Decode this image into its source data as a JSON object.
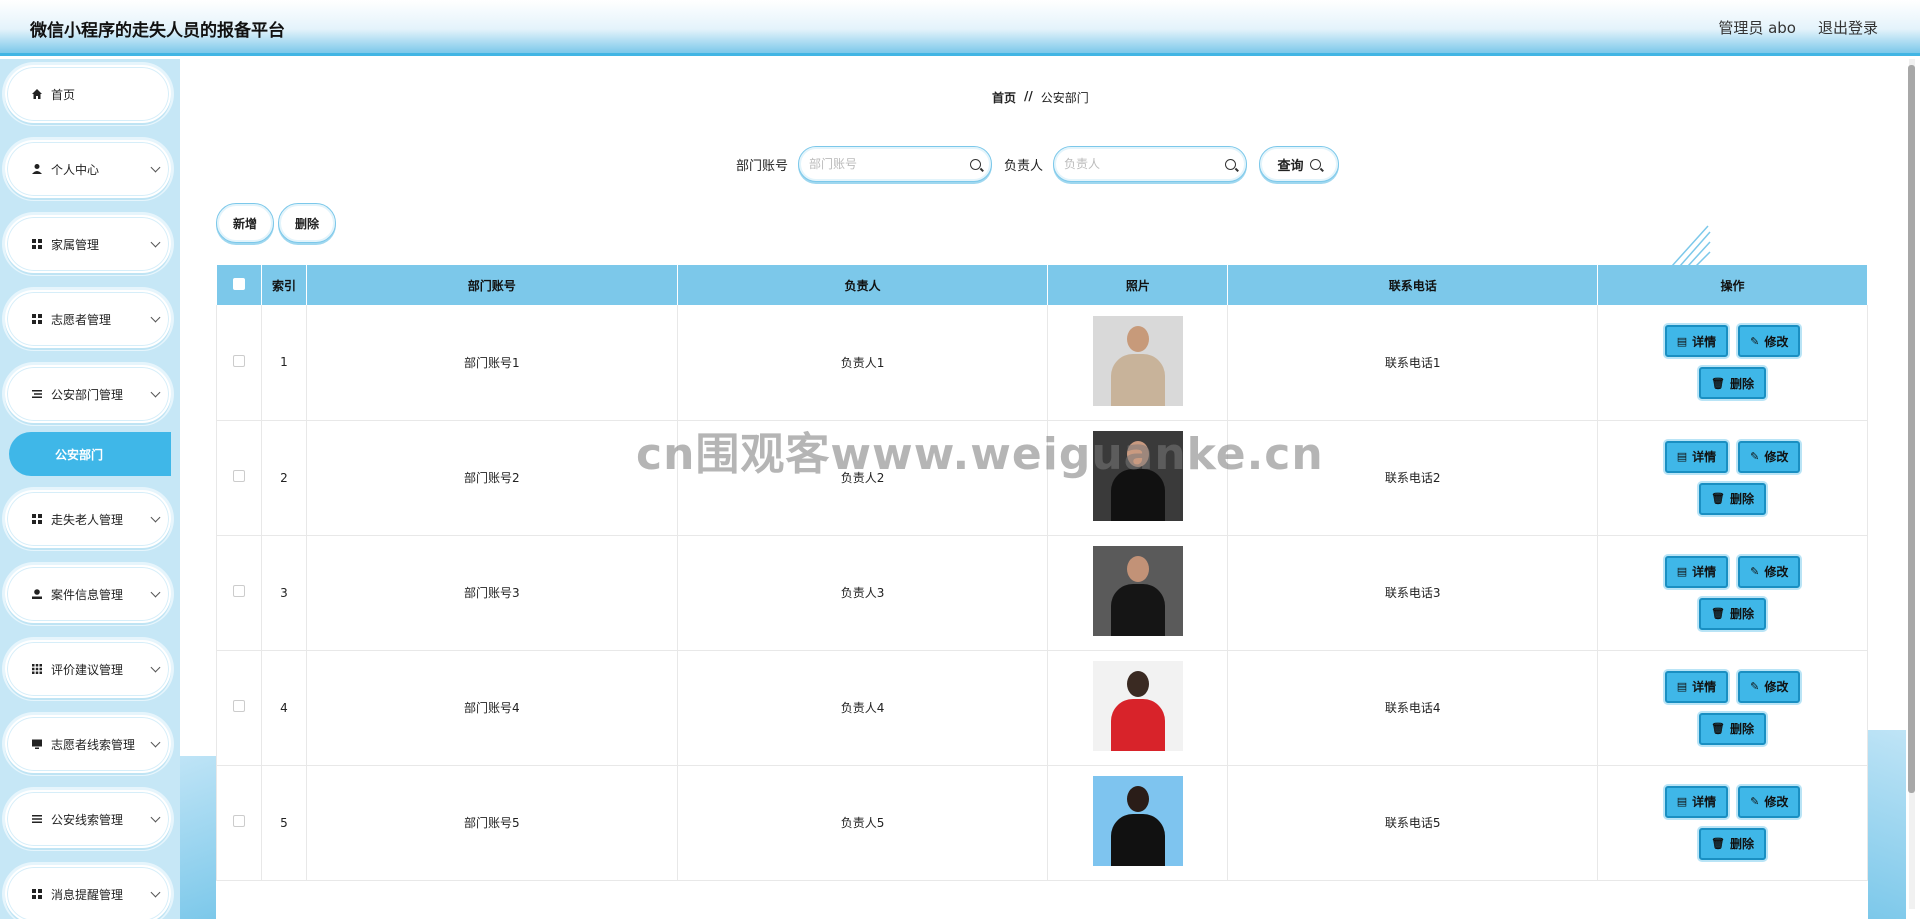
{
  "header": {
    "title": "微信小程序的走失人员的报备平台",
    "user_label": "管理员 abo",
    "logout_label": "退出登录"
  },
  "sidebar": {
    "items": [
      {
        "label": "首页",
        "icon": "home-icon",
        "has_children": false
      },
      {
        "label": "个人中心",
        "icon": "user-icon",
        "has_children": true
      },
      {
        "label": "家属管理",
        "icon": "grid-icon",
        "has_children": true
      },
      {
        "label": "志愿者管理",
        "icon": "grid-icon",
        "has_children": true
      },
      {
        "label": "公安部门管理",
        "icon": "list-icon",
        "has_children": true
      },
      {
        "label": "走失老人管理",
        "icon": "grid-icon",
        "has_children": true
      },
      {
        "label": "案件信息管理",
        "icon": "person-icon",
        "has_children": true
      },
      {
        "label": "评价建议管理",
        "icon": "apps-icon",
        "has_children": true
      },
      {
        "label": "志愿者线索管理",
        "icon": "monitor-icon",
        "has_children": true
      },
      {
        "label": "公安线索管理",
        "icon": "menu-icon",
        "has_children": true
      },
      {
        "label": "消息提醒管理",
        "icon": "grid-icon",
        "has_children": true
      }
    ],
    "active_sub": "公安部门"
  },
  "breadcrumb": {
    "home": "首页",
    "sep": "//",
    "current": "公安部门"
  },
  "search": {
    "field1_label": "部门账号",
    "field1_placeholder": "部门账号",
    "field1_value": "",
    "field2_label": "负责人",
    "field2_placeholder": "负责人",
    "field2_value": "",
    "query_label": "查询"
  },
  "actions": {
    "add_label": "新增",
    "delete_label": "删除"
  },
  "table": {
    "columns": [
      "索引",
      "部门账号",
      "负责人",
      "照片",
      "联系电话",
      "操作"
    ],
    "rows": [
      {
        "index": "1",
        "account": "部门账号1",
        "leader": "负责人1",
        "phone": "联系电话1"
      },
      {
        "index": "2",
        "account": "部门账号2",
        "leader": "负责人2",
        "phone": "联系电话2"
      },
      {
        "index": "3",
        "account": "部门账号3",
        "leader": "负责人3",
        "phone": "联系电话3"
      },
      {
        "index": "4",
        "account": "部门账号4",
        "leader": "负责人4",
        "phone": "联系电话4"
      },
      {
        "index": "5",
        "account": "部门账号5",
        "leader": "负责人5",
        "phone": "联系电话5"
      }
    ],
    "op_detail": "详情",
    "op_edit": "修改",
    "op_delete": "删除"
  },
  "watermark": "cn围观客www.weiguanke.cn",
  "colors": {
    "accent": "#3fb7e8",
    "header_bg": "#7cc8ea",
    "sidebar_bg": "#c6e7f6"
  }
}
